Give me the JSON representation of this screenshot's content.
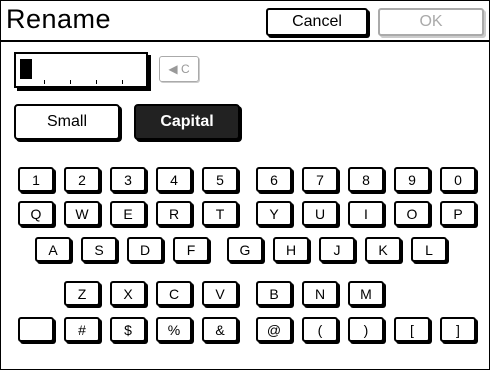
{
  "title": "Rename",
  "buttons": {
    "cancel": "Cancel",
    "ok": "OK",
    "clear": "◀ C"
  },
  "name_value": "",
  "modes": {
    "small": "Small",
    "capital": "Capital",
    "selected": "Capital"
  },
  "keyboard": {
    "row1": [
      "1",
      "2",
      "3",
      "4",
      "5",
      "6",
      "7",
      "8",
      "9",
      "0"
    ],
    "row2": [
      "Q",
      "W",
      "E",
      "R",
      "T",
      "Y",
      "U",
      "I",
      "O",
      "P"
    ],
    "row3": [
      "A",
      "S",
      "D",
      "F",
      "G",
      "H",
      "J",
      "K",
      "L"
    ],
    "row4": [
      "Z",
      "X",
      "C",
      "V",
      "B",
      "N",
      "M"
    ],
    "row5": [
      "",
      "#",
      "$",
      "%",
      "&",
      "@",
      "(",
      ")",
      "[",
      "]"
    ]
  }
}
